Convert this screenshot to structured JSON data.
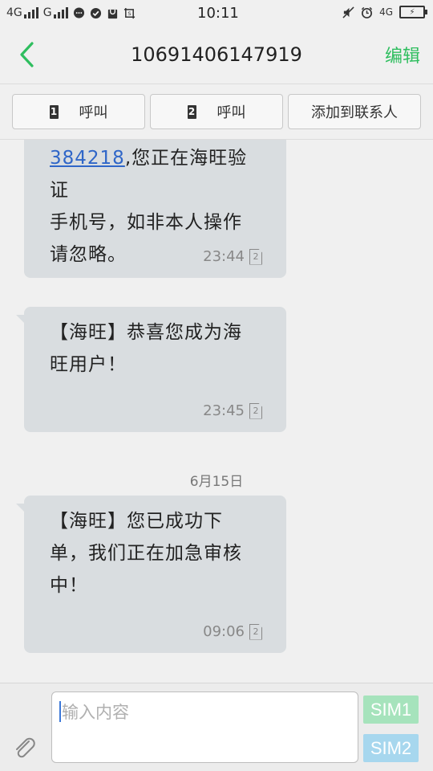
{
  "status_bar": {
    "sim1_network": "4G",
    "sim2_network": "G",
    "time": "10:11",
    "right_network": "4G"
  },
  "header": {
    "title": "10691406147919",
    "edit_label": "编辑"
  },
  "actions": {
    "call1_sim": "1",
    "call1_label": "呼叫",
    "call2_sim": "2",
    "call2_label": "呼叫",
    "add_contact_label": "添加到联系人"
  },
  "messages": [
    {
      "code": "384218",
      "text_line1_rest": ",您正在海旺验证",
      "text_rest": "手机号，如非本人操作请忽略。",
      "time": "23:44",
      "sim": "2"
    },
    {
      "text": "【海旺】恭喜您成为海旺用户！",
      "time": "23:45",
      "sim": "2"
    },
    {
      "text": "【海旺】您已成功下单，我们正在加急审核中！",
      "time": "09:06",
      "sim": "2"
    }
  ],
  "date_separator": "6月15日",
  "composer": {
    "placeholder": "输入内容",
    "sim1_label": "SIM1",
    "sim2_label": "SIM2"
  },
  "colors": {
    "accent_green": "#2fbe5f",
    "bubble": "#d9dde0",
    "link": "#2f66c8",
    "sim1_button": "#a6e3bc",
    "sim2_button": "#a7d7ee"
  }
}
